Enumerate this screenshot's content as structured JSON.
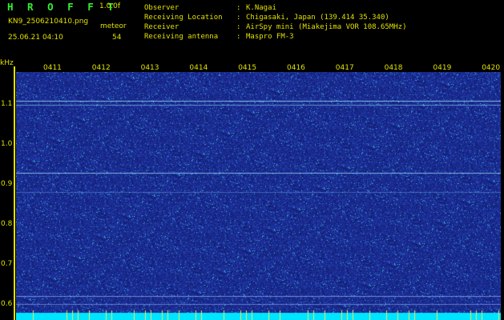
{
  "header": {
    "app_title": "H R O F F T",
    "version": "1.0.0f",
    "filename": "KN9_2506210410.png",
    "meteor_label": "meteor",
    "datetime": "25.06.21 04:10",
    "meteor_count": "54",
    "info": [
      {
        "key": "Observer",
        "value": "K.Nagai"
      },
      {
        "key": "Receiving Location",
        "value": "Chigasaki, Japan (139.414 35.340)"
      },
      {
        "key": "Receiver",
        "value": "AirSpy mini (Miakejima VOR 108.65MHz)"
      },
      {
        "key": "Receiving antenna",
        "value": "Maspro FM-3"
      }
    ]
  },
  "axis": {
    "unit": "kHz",
    "time_ticks": [
      "0411",
      "0412",
      "0413",
      "0414",
      "0415",
      "0416",
      "0417",
      "0418",
      "0419",
      "0420"
    ],
    "freq_ticks": [
      "1.1",
      "1.0",
      "0.9",
      "0.8",
      "0.7",
      "0.6"
    ]
  },
  "colors": {
    "label": "#e0e000",
    "title": "#33ee33",
    "background": "#1c2a8a",
    "noise_floor": "#00e5ff"
  }
}
